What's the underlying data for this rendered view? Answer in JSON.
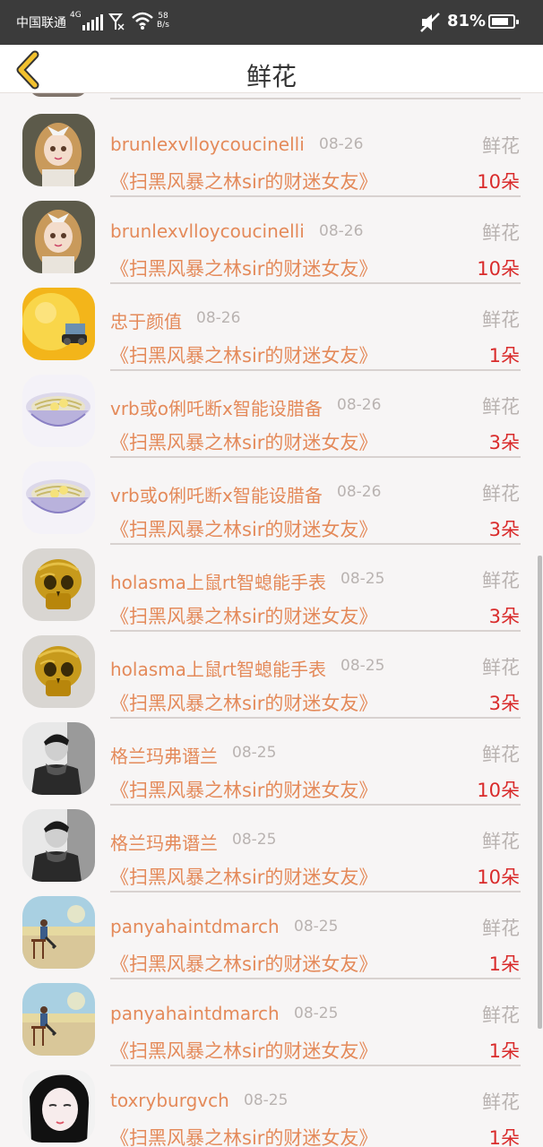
{
  "status_bar": {
    "carrier": "中国联通",
    "network": "4G",
    "speed_value": "58",
    "speed_unit": "B/s",
    "battery_percent": "81%",
    "battery_level": 0.81
  },
  "nav": {
    "title": "鲜花"
  },
  "gift_label": "鲜花",
  "items": [
    {
      "name": "brunlexvlloycoucinelli",
      "date": "08-26",
      "work": "《扫黑风暴之林sir的财迷女友》",
      "count": "10朵",
      "avatar": "doll"
    },
    {
      "name": "brunlexvlloycoucinelli",
      "date": "08-26",
      "work": "《扫黑风暴之林sir的财迷女友》",
      "count": "10朵",
      "avatar": "doll"
    },
    {
      "name": "忠于颜值",
      "date": "08-26",
      "work": "《扫黑风暴之林sir的财迷女友》",
      "count": "1朵",
      "avatar": "yellow"
    },
    {
      "name": "vrb或o俐吒断x智能设腊备",
      "date": "08-26",
      "work": "《扫黑风暴之林sir的财迷女友》",
      "count": "3朵",
      "avatar": "bowl"
    },
    {
      "name": "vrb或o俐吒断x智能设腊备",
      "date": "08-26",
      "work": "《扫黑风暴之林sir的财迷女友》",
      "count": "3朵",
      "avatar": "bowl"
    },
    {
      "name": "holasma上鼠rt智螅能手表",
      "date": "08-25",
      "work": "《扫黑风暴之林sir的财迷女友》",
      "count": "3朵",
      "avatar": "skull"
    },
    {
      "name": "holasma上鼠rt智螅能手表",
      "date": "08-25",
      "work": "《扫黑风暴之林sir的财迷女友》",
      "count": "3朵",
      "avatar": "skull"
    },
    {
      "name": "格兰玛弗谮兰",
      "date": "08-25",
      "work": "《扫黑风暴之林sir的财迷女友》",
      "count": "10朵",
      "avatar": "man"
    },
    {
      "name": "格兰玛弗谮兰",
      "date": "08-25",
      "work": "《扫黑风暴之林sir的财迷女友》",
      "count": "10朵",
      "avatar": "man"
    },
    {
      "name": "panyahaintdmarch",
      "date": "08-25",
      "work": "《扫黑风暴之林sir的财迷女友》",
      "count": "1朵",
      "avatar": "sea"
    },
    {
      "name": "panyahaintdmarch",
      "date": "08-25",
      "work": "《扫黑风暴之林sir的财迷女友》",
      "count": "1朵",
      "avatar": "sea"
    },
    {
      "name": "toxryburgvch",
      "date": "08-25",
      "work": "《扫黑风暴之林sir的财迷女友》",
      "count": "1朵",
      "avatar": "girl"
    }
  ]
}
